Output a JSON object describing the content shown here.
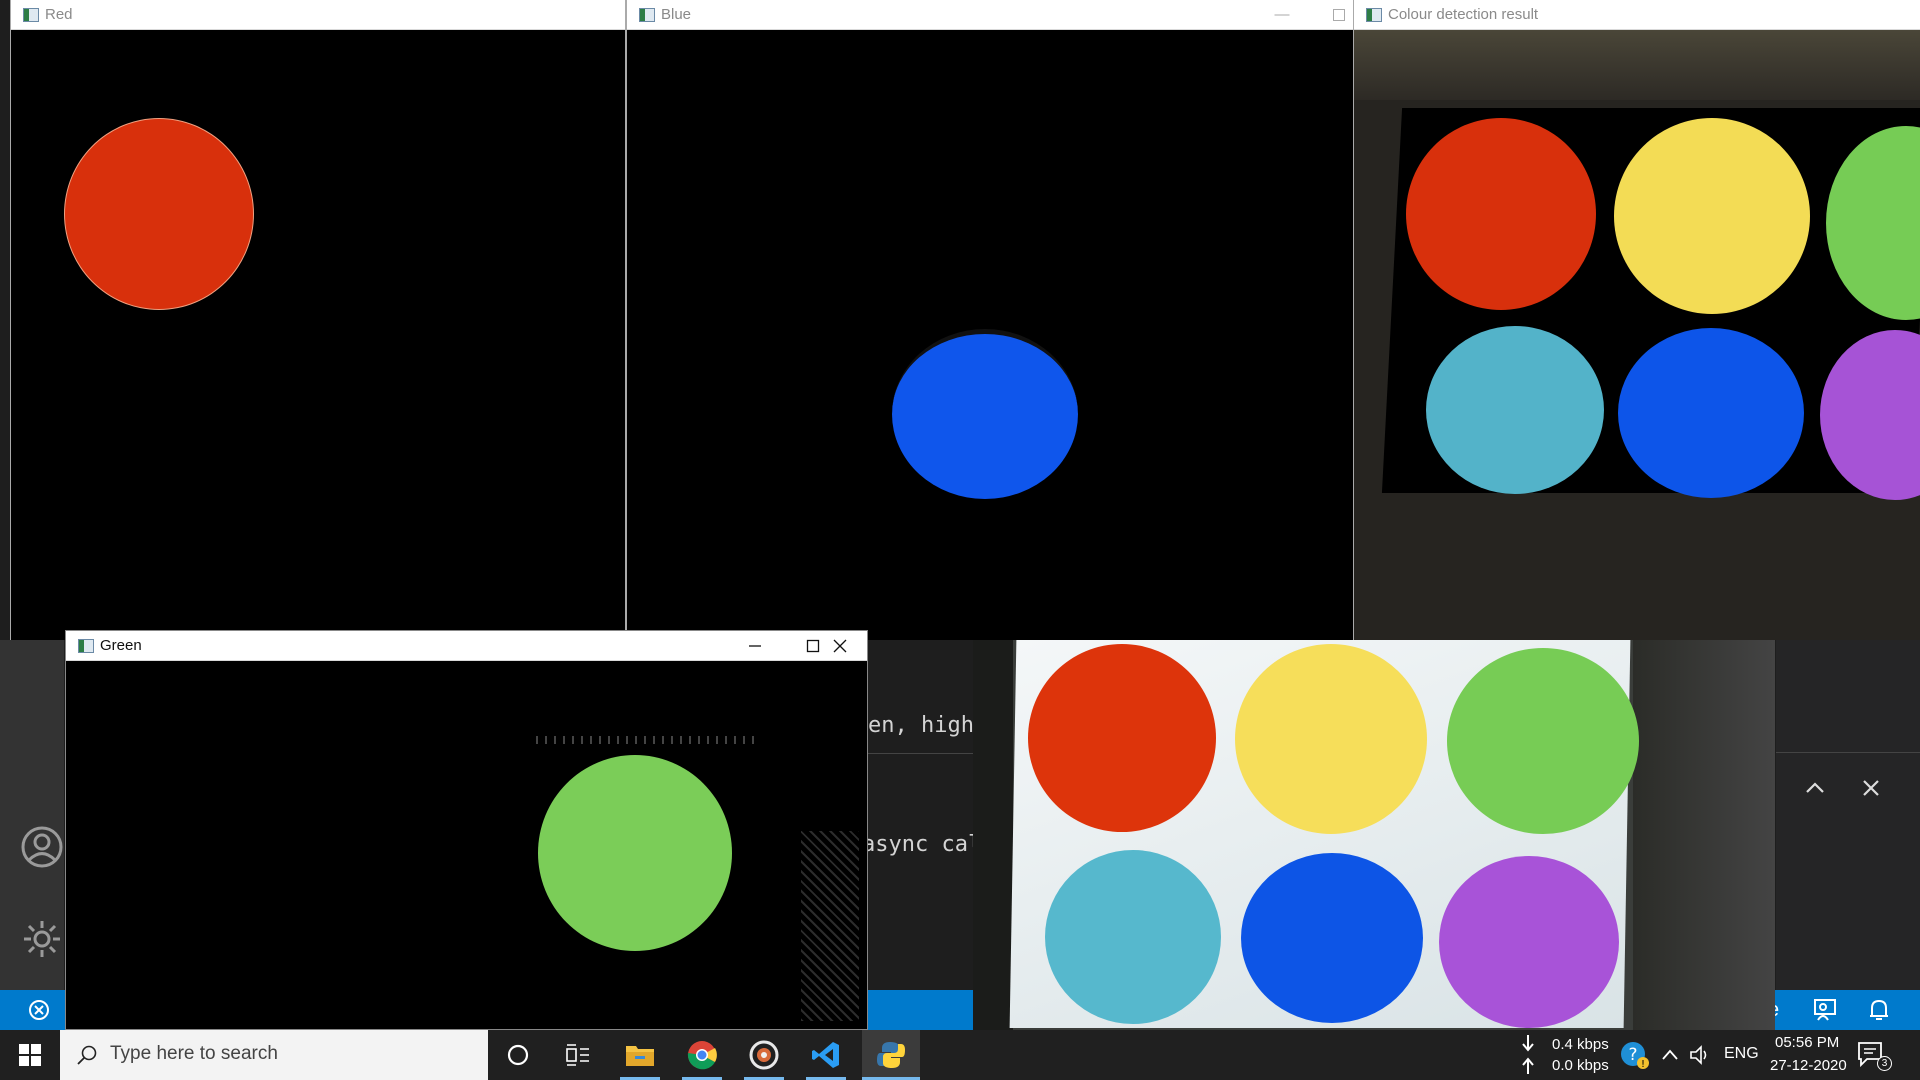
{
  "windows": {
    "red": {
      "title": "Red"
    },
    "blue": {
      "title": "Blue"
    },
    "result": {
      "title": "Colour detection result"
    },
    "green": {
      "title": "Green"
    }
  },
  "editor": {
    "code_line_1": "en, high",
    "code_line_2": "async cal",
    "statusbar_fragment": "e"
  },
  "taskbar": {
    "search_placeholder": "Type here to search",
    "net_down": "0.4 kbps",
    "net_up": "0.0 kbps",
    "language": "ENG",
    "time": "05:56 PM",
    "date": "27-12-2020",
    "notification_count": "3"
  },
  "colors": {
    "red_disc": "#d92f0b",
    "yellow_disc": "#f3dc55",
    "green_disc": "#76cc55",
    "cyan_disc": "#52b3c9",
    "blue_disc": "#0d55e9",
    "purple_disc": "#a653d6",
    "vscode_status": "#007acc"
  }
}
